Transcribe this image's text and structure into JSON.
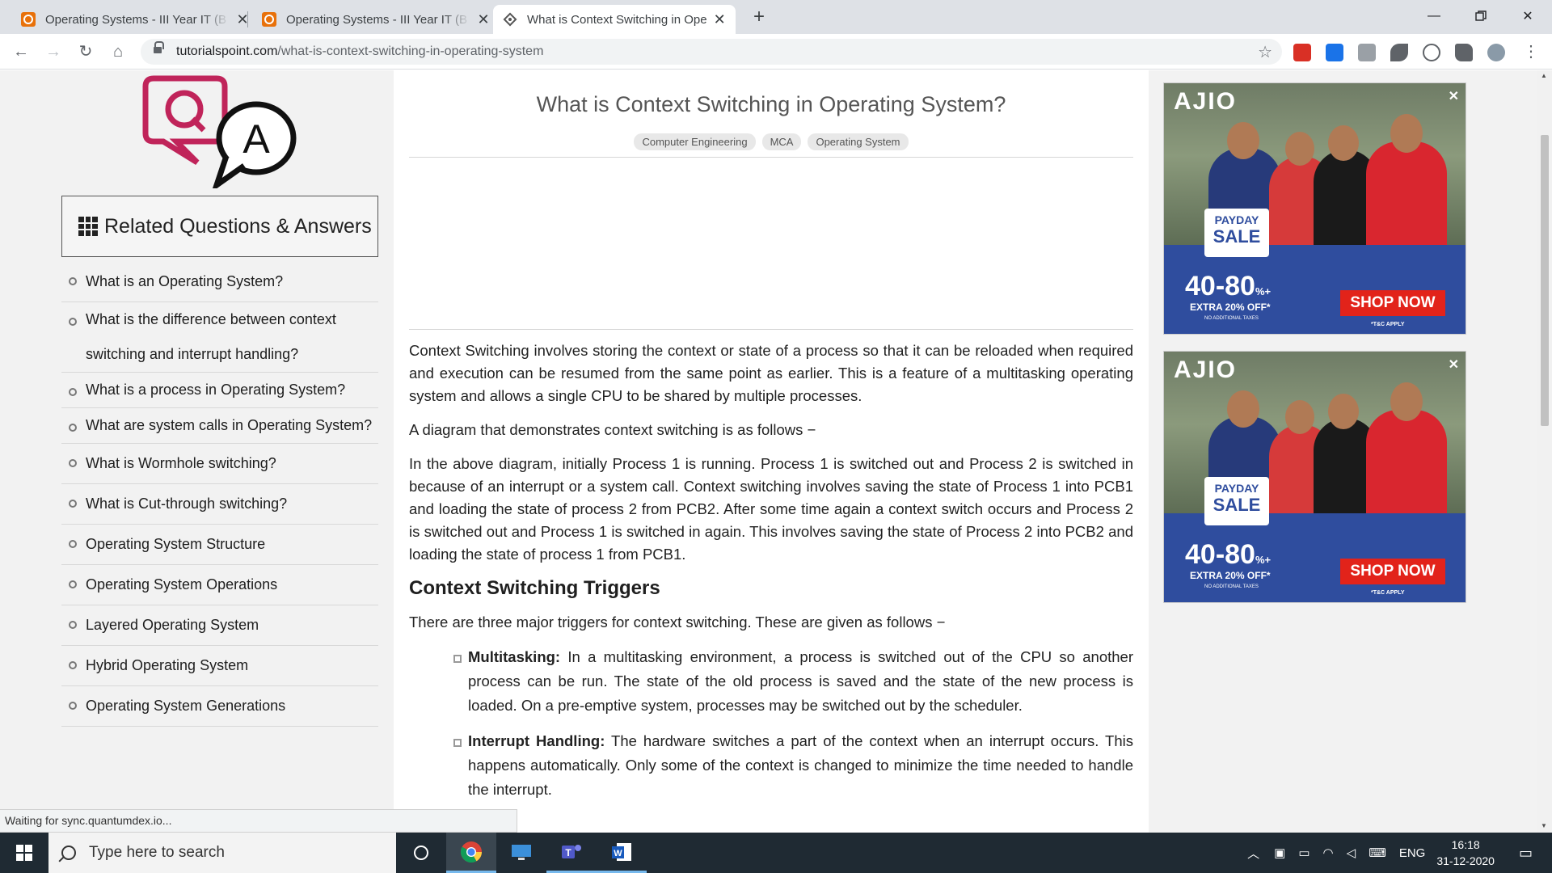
{
  "browser": {
    "tabs": [
      {
        "title": "Operating Systems - III Year IT (B",
        "active": false
      },
      {
        "title": "Operating Systems - III Year IT (B",
        "active": false
      },
      {
        "title": "What is Context Switching in Ope",
        "active": true
      }
    ],
    "url_domain": "tutorialspoint.com",
    "url_path": "/what-is-context-switching-in-operating-system"
  },
  "sidebar": {
    "related_title": "Related Questions & Answers",
    "items": [
      "What is an Operating System?",
      "What is the difference between context switching and interrupt handling?",
      "What is a process in Operating System?",
      "What are system calls in Operating System?",
      "What is Wormhole switching?",
      "What is Cut-through switching?",
      "Operating System Structure",
      "Operating System Operations",
      "Layered Operating System",
      "Hybrid Operating System",
      "Operating System Generations"
    ]
  },
  "article": {
    "title": "What is Context Switching in Operating System?",
    "tags": [
      "Computer Engineering",
      "MCA",
      "Operating System"
    ],
    "p1": "Context Switching involves storing the context or state of a process so that it can be reloaded when required and execution can be resumed from the same point as earlier. This is a feature of a multitasking operating system and allows a single CPU to be shared by multiple processes.",
    "p2": "A diagram that demonstrates context switching is as follows −",
    "p3": "In the above diagram, initially Process 1 is running. Process 1 is switched out and Process 2 is switched in because of an interrupt or a system call. Context switching involves saving the state of Process 1 into PCB1 and loading the state of process 2 from PCB2. After some time again a context switch occurs and Process 2 is switched out and Process 1 is switched in again. This involves saving the state of Process 2 into PCB2 and loading the state of process 1 from PCB1.",
    "h2": "Context Switching Triggers",
    "p4": "There are three major triggers for context switching. These are given as follows −",
    "bullets": [
      {
        "term": "Multitasking:",
        "text": " In a multitasking environment, a process is switched out of the CPU so another process can be run. The state of the old process is saved and the state of the new process is loaded. On a pre-emptive system, processes may be switched out by the scheduler."
      },
      {
        "term": "Interrupt Handling:",
        "text": " The hardware switches a part of the context when an interrupt occurs. This happens automatically. Only some of the context is changed to minimize the time needed to handle the interrupt."
      }
    ]
  },
  "ads": [
    {
      "brand": "AJIO",
      "badge_top": "PAYDAY",
      "badge_bottom": "SALE",
      "discount": "40-80",
      "discount_suffix": "%+",
      "extra": "EXTRA 20% OFF*",
      "fine": "NO ADDITIONAL TAXES",
      "cta": "SHOP NOW",
      "tc": "*T&C APPLY",
      "close": "✕"
    },
    {
      "brand": "AJIO",
      "badge_top": "PAYDAY",
      "badge_bottom": "SALE",
      "discount": "40-80",
      "discount_suffix": "%+",
      "extra": "EXTRA 20% OFF*",
      "fine": "NO ADDITIONAL TAXES",
      "cta": "SHOP NOW",
      "tc": "*T&C APPLY",
      "close": "✕"
    }
  ],
  "status_text": "Waiting for sync.quantumdex.io...",
  "taskbar": {
    "search_placeholder": "Type here to search",
    "language": "ENG",
    "time": "16:18",
    "date": "31-12-2020"
  }
}
